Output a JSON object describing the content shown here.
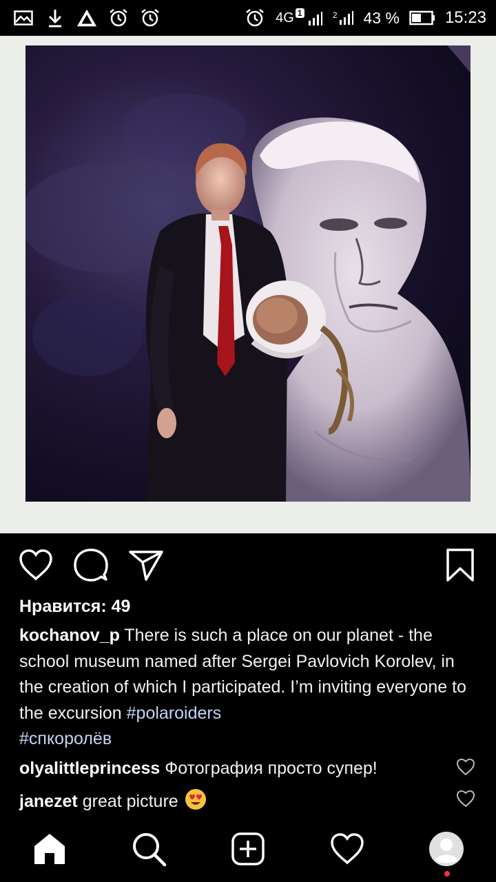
{
  "status_bar": {
    "icons_left": [
      "image-icon",
      "download-icon",
      "warning-icon",
      "alarm-icon",
      "alarm-icon"
    ],
    "network": "4G",
    "sim1": "1",
    "sim2": "2",
    "battery": "43 %",
    "time": "15:23"
  },
  "post": {
    "likes_text": "Нравится: 49",
    "author": "kochanov_p",
    "caption_text": " There is such a place on our planet - the school museum named after Sergei Pavlovich Korolev, in the creation of which I participated. I’m inviting everyone to the excursion ",
    "hashtags": [
      "#polaroiders",
      "#спкоролёв"
    ],
    "comments": [
      {
        "user": "olyalittleprincess",
        "text": " Фотография просто супер!"
      },
      {
        "user": "janezet",
        "text": " great picture "
      }
    ]
  },
  "actions": [
    "like-icon",
    "comment-icon",
    "share-icon",
    "save-icon"
  ],
  "bottom_nav": [
    "home-icon",
    "search-icon",
    "add-post-icon",
    "activity-icon",
    "profile-icon"
  ],
  "colors": {
    "background": "#000000",
    "hashtag": "#c4d4f4",
    "notification_dot": "#ff3040"
  }
}
